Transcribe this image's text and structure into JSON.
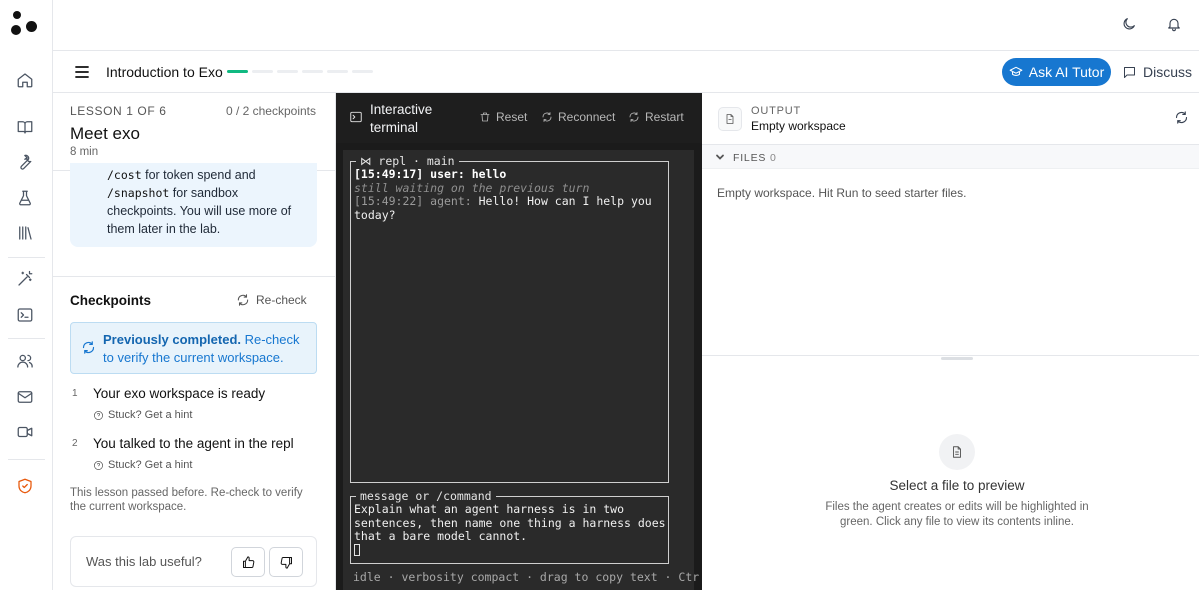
{
  "header": {
    "course_title": "Introduction to Exo",
    "progress_segments": {
      "total": 6,
      "completed": 1
    },
    "ask_tutor_label": "Ask AI Tutor",
    "discuss_label": "Discuss"
  },
  "rail": {
    "icons": [
      "home-icon",
      "book-icon",
      "wrench-icon",
      "flask-icon",
      "library-icon",
      "magic-wand-icon",
      "terminal-icon",
      "users-icon",
      "mail-icon",
      "video-icon",
      "shield-icon"
    ]
  },
  "lesson": {
    "meta": "LESSON 1 OF 6",
    "checkpoints_count": "0 / 2 checkpoints",
    "title": "Meet exo",
    "duration": "8 min",
    "note": {
      "cmd1": "/cost",
      "text1": " for token spend and",
      "cmd2": "/snapshot",
      "text2": " for sandbox checkpoints. You will use more of them later in the lab."
    },
    "checkpoints_heading": "Checkpoints",
    "recheck_label": "Re-check",
    "previously_bold": "Previously completed.",
    "previously_text": " Re-check to verify the current workspace.",
    "checkpoints": [
      {
        "num": "1",
        "text": "Your exo workspace is ready",
        "hint": "Stuck? Get a hint"
      },
      {
        "num": "2",
        "text": "You talked to the agent in the repl",
        "hint": "Stuck? Get a hint"
      }
    ],
    "passed_note": "This lesson passed before. Re-check to verify the current workspace.",
    "useful_label": "Was this lab useful?"
  },
  "terminal": {
    "title": "Interactive terminal",
    "reset_label": "Reset",
    "reconnect_label": "Reconnect",
    "restart_label": "Restart",
    "repl_label": "⋈ repl · main",
    "user_line": "[15:49:17] user: hello",
    "waiting_line": "still waiting on the previous turn",
    "agent_prefix": "[15:49:22] agent:",
    "agent_text": " Hello! How can I help you today?",
    "input_label": "message or /command",
    "input_text": "Explain what an agent harness is in two sentences, then name one thing a harness does that a bare model cannot.",
    "status_line": "idle · verbosity compact · drag to copy text · Ctr"
  },
  "output": {
    "label": "OUTPUT",
    "subtitle": "Empty workspace",
    "files_label": "FILES",
    "files_count": "0",
    "empty_message": "Empty workspace. Hit Run to seed starter files.",
    "preview_title": "Select a file to preview",
    "preview_desc": "Files the agent creates or edits will be highlighted in green. Click any file to view its contents inline."
  },
  "colors": {
    "accent": "#1777d0",
    "progress": "#10b981",
    "shield": "#e8590c"
  }
}
